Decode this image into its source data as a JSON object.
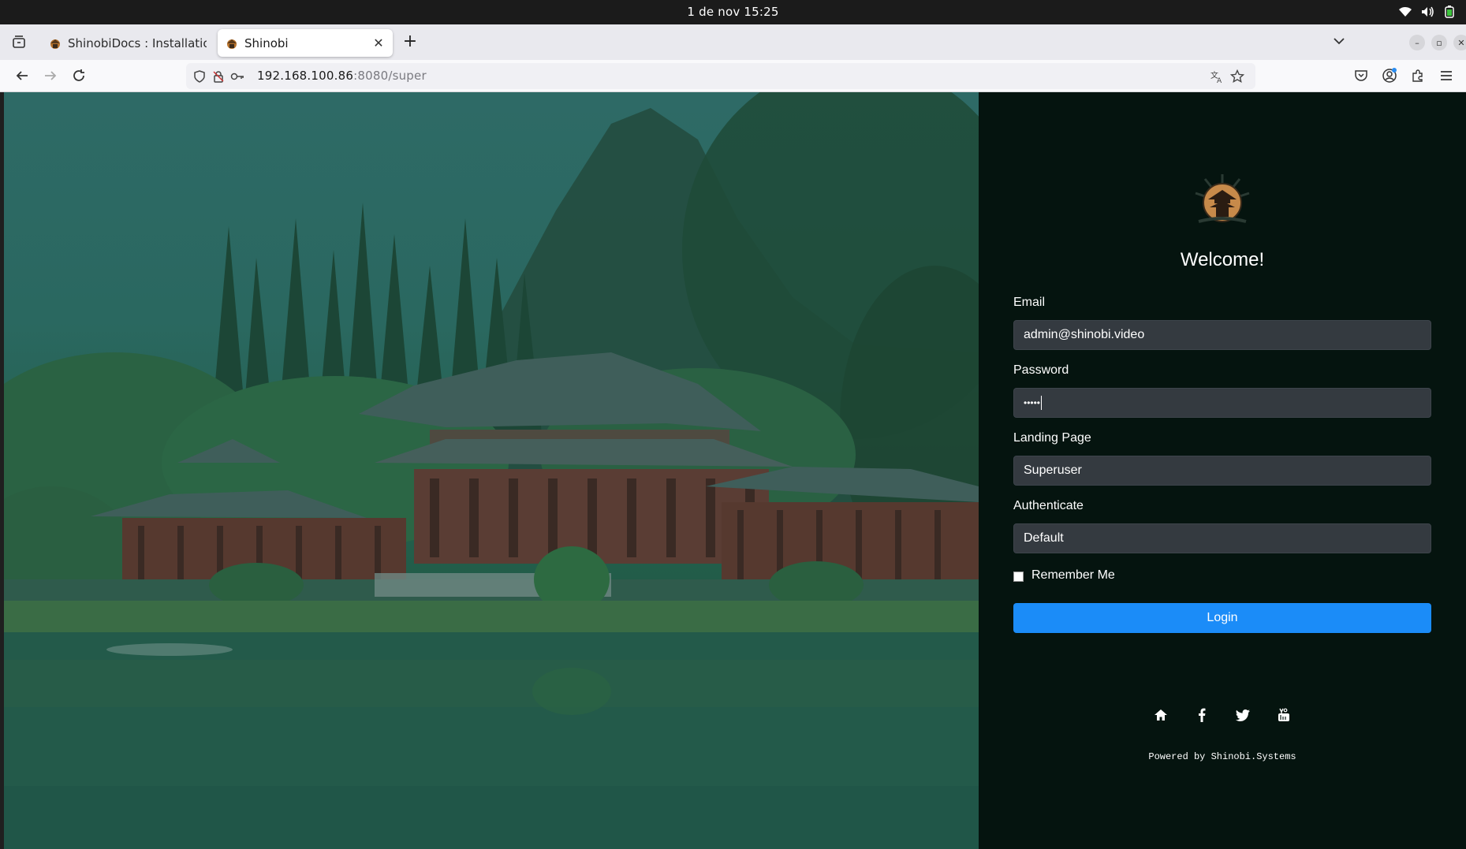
{
  "system": {
    "clock": "1 de nov  15:25",
    "tray_icons": [
      "wifi-icon",
      "volume-icon",
      "battery-icon"
    ]
  },
  "browser": {
    "tabs": [
      {
        "title": "ShinobiDocs : Installation >",
        "active": false
      },
      {
        "title": "Shinobi",
        "active": true
      }
    ],
    "url_host": "192.168.100.86",
    "url_rest": ":8080/super"
  },
  "login": {
    "welcome": "Welcome!",
    "email_label": "Email",
    "email_value": "admin@shinobi.video",
    "password_label": "Password",
    "password_value": "•••••",
    "landing_label": "Landing Page",
    "landing_value": "Superuser",
    "auth_label": "Authenticate",
    "auth_value": "Default",
    "remember_label": "Remember Me",
    "login_button": "Login",
    "powered_by": "Powered by Shinobi.Systems"
  },
  "colors": {
    "panel_bg": "#05140f",
    "input_bg": "#343a40",
    "accent": "#1b8cf8"
  }
}
